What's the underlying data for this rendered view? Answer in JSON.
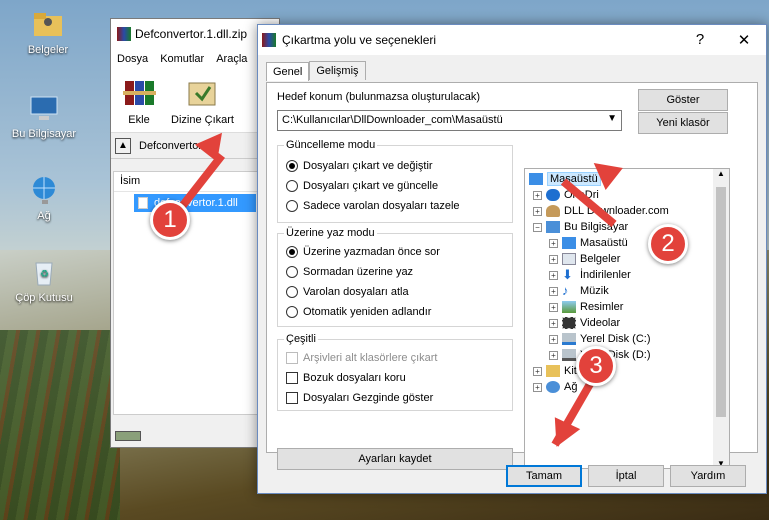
{
  "desktop": {
    "icons": [
      {
        "label": "Belgeler"
      },
      {
        "label": "Bu Bilgisayar"
      },
      {
        "label": "Ağ"
      },
      {
        "label": "Çöp Kutusu"
      }
    ]
  },
  "bg_window": {
    "title": "Defconvertor.1.dll.zip",
    "menu": [
      "Dosya",
      "Komutlar",
      "Araçla"
    ],
    "tools": [
      {
        "label": "Ekle"
      },
      {
        "label": "Dizine Çıkart"
      }
    ],
    "address": "Defconvertor",
    "column_name": "İsim",
    "file": "defconvertor.1.dll"
  },
  "dialog": {
    "title": "Çıkartma yolu ve seçenekleri",
    "close_label": "✕",
    "help_label": "?",
    "tabs": [
      {
        "label": "Genel"
      },
      {
        "label": "Gelişmiş"
      }
    ],
    "dest_label": "Hedef konum (bulunmazsa oluşturulacak)",
    "dest_value": "C:\\Kullanıcılar\\DllDownloader_com\\Masaüstü",
    "show_button": "Göster",
    "new_folder_button": "Yeni klasör",
    "update_group": {
      "title": "Güncelleme modu",
      "options": [
        {
          "label": "Dosyaları çıkart ve değiştir",
          "selected": true
        },
        {
          "label": "Dosyaları çıkart ve güncelle",
          "selected": false
        },
        {
          "label": "Sadece varolan dosyaları tazele",
          "selected": false
        }
      ]
    },
    "overwrite_group": {
      "title": "Üzerine yaz modu",
      "options": [
        {
          "label": "Üzerine yazmadan önce sor",
          "selected": true
        },
        {
          "label": "Sormadan üzerine yaz",
          "selected": false
        },
        {
          "label": "Varolan dosyaları atla",
          "selected": false
        },
        {
          "label": "Otomatik yeniden adlandır",
          "selected": false
        }
      ]
    },
    "misc_group": {
      "title": "Çeşitli",
      "options": [
        {
          "label": "Arşivleri alt klasörlere çıkart",
          "checked": false,
          "disabled": true
        },
        {
          "label": "Bozuk dosyaları koru",
          "checked": false,
          "disabled": false
        },
        {
          "label": "Dosyaları Gezginde göster",
          "checked": false,
          "disabled": false
        }
      ]
    },
    "save_settings_button": "Ayarları kaydet",
    "tree": [
      {
        "label": "Masaüstü",
        "selected": true
      },
      {
        "label": "OneDri"
      },
      {
        "label": "DLL Downloader.com"
      },
      {
        "label": "Bu Bilgisayar"
      },
      {
        "label": "Masaüstü"
      },
      {
        "label": "Belgeler"
      },
      {
        "label": "İndirilenler"
      },
      {
        "label": "Müzik"
      },
      {
        "label": "Resimler"
      },
      {
        "label": "Videolar"
      },
      {
        "label": "Yerel Disk (C:)"
      },
      {
        "label": "Yerel Disk (D:)"
      },
      {
        "label": "Kitaplıklar"
      },
      {
        "label": "Ağ"
      }
    ],
    "ok_button": "Tamam",
    "cancel_button": "İptal",
    "help_button": "Yardım"
  },
  "annotations": {
    "badges": [
      "1",
      "2",
      "3"
    ],
    "color": "#e2423b"
  }
}
